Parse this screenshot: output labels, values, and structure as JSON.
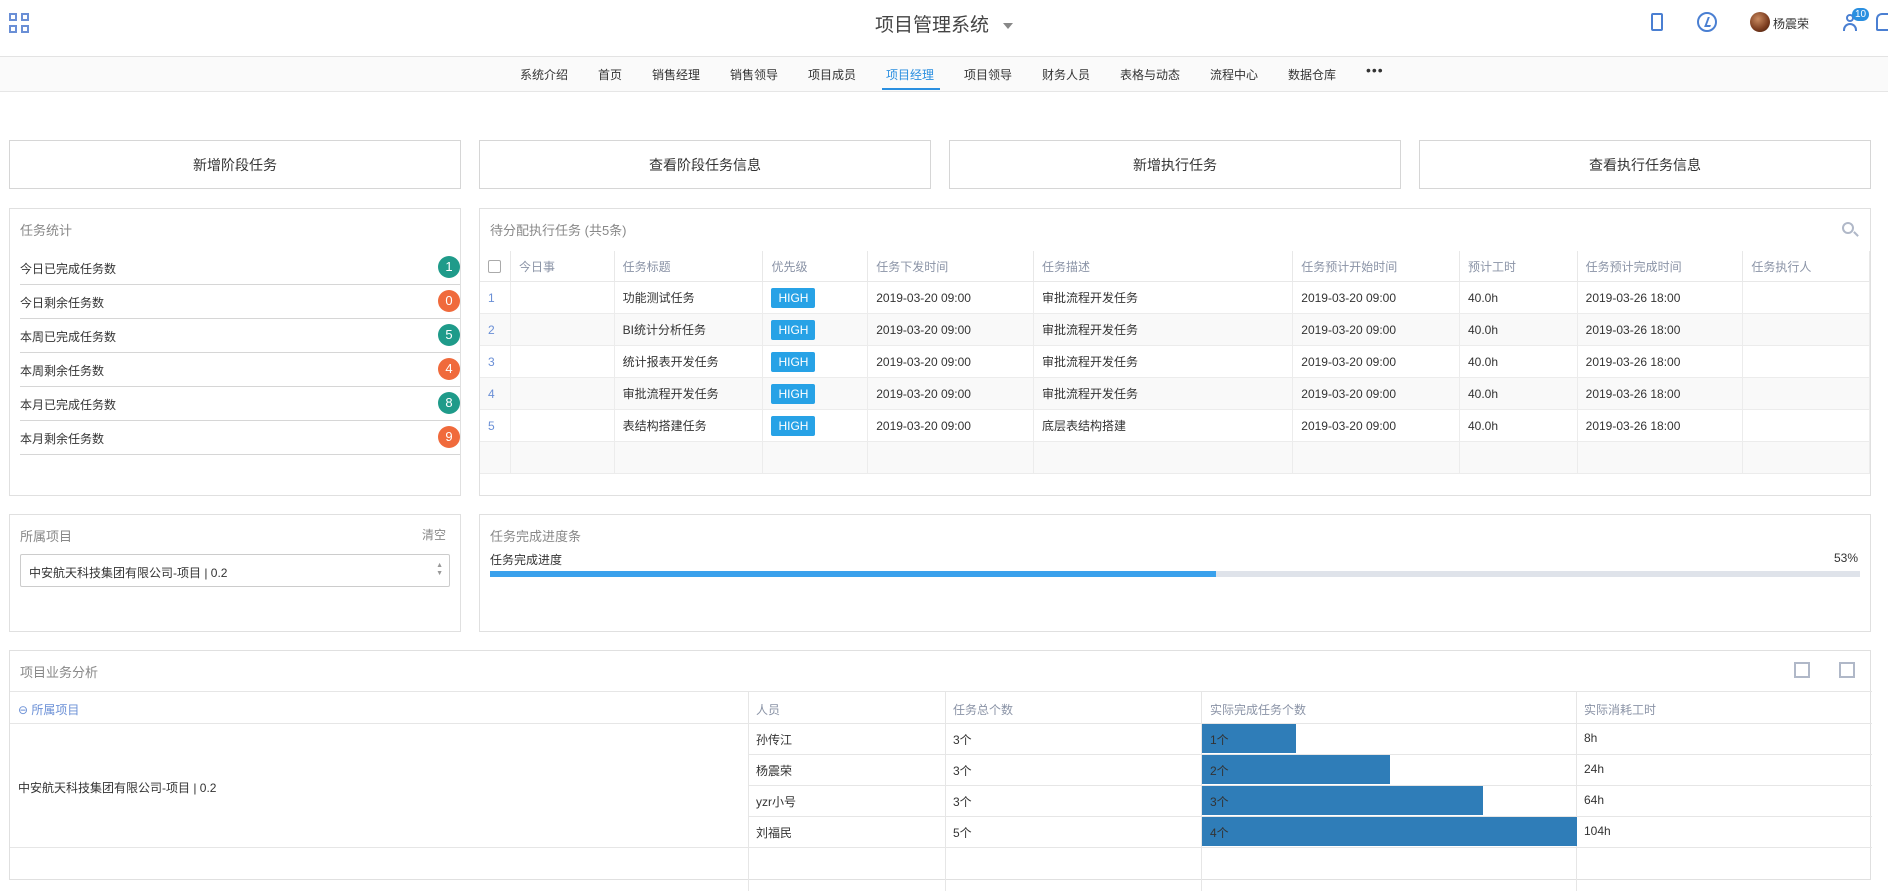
{
  "app": {
    "title": "项目管理系统",
    "user": "杨震荣",
    "notification_count": "10"
  },
  "nav": {
    "items": [
      "系统介绍",
      "首页",
      "销售经理",
      "销售领导",
      "项目成员",
      "项目经理",
      "项目领导",
      "财务人员",
      "表格与动态",
      "流程中心",
      "数据仓库"
    ],
    "active": "项目经理",
    "more": "•••"
  },
  "actions": [
    "新增阶段任务",
    "查看阶段任务信息",
    "新增执行任务",
    "查看执行任务信息"
  ],
  "stats": {
    "title": "任务统计",
    "items": [
      {
        "label": "今日已完成任务数",
        "value": "1",
        "color": "#1f9b8a"
      },
      {
        "label": "今日剩余任务数",
        "value": "0",
        "color": "#f06a3c"
      },
      {
        "label": "本周已完成任务数",
        "value": "5",
        "color": "#1f9b8a"
      },
      {
        "label": "本周剩余任务数",
        "value": "4",
        "color": "#f06a3c"
      },
      {
        "label": "本月已完成任务数",
        "value": "8",
        "color": "#1f9b8a"
      },
      {
        "label": "本月剩余任务数",
        "value": "9",
        "color": "#f06a3c"
      }
    ]
  },
  "tasks": {
    "title": "待分配执行任务 (共5条)",
    "columns": [
      "今日事",
      "任务标题",
      "优先级",
      "任务下发时间",
      "任务描述",
      "任务预计开始时间",
      "预计工时",
      "任务预计完成时间",
      "任务执行人"
    ],
    "rows": [
      {
        "n": "1",
        "title": "功能测试任务",
        "priority": "HIGH",
        "issued": "2019-03-20 09:00",
        "desc": "审批流程开发任务",
        "start": "2019-03-20 09:00",
        "hours": "40.0h",
        "finish": "2019-03-26 18:00"
      },
      {
        "n": "2",
        "title": "BI统计分析任务",
        "priority": "HIGH",
        "issued": "2019-03-20 09:00",
        "desc": "审批流程开发任务",
        "start": "2019-03-20 09:00",
        "hours": "40.0h",
        "finish": "2019-03-26 18:00"
      },
      {
        "n": "3",
        "title": "统计报表开发任务",
        "priority": "HIGH",
        "issued": "2019-03-20 09:00",
        "desc": "审批流程开发任务",
        "start": "2019-03-20 09:00",
        "hours": "40.0h",
        "finish": "2019-03-26 18:00"
      },
      {
        "n": "4",
        "title": "审批流程开发任务",
        "priority": "HIGH",
        "issued": "2019-03-20 09:00",
        "desc": "审批流程开发任务",
        "start": "2019-03-20 09:00",
        "hours": "40.0h",
        "finish": "2019-03-26 18:00"
      },
      {
        "n": "5",
        "title": "表结构搭建任务",
        "priority": "HIGH",
        "issued": "2019-03-20 09:00",
        "desc": "底层表结构搭建",
        "start": "2019-03-20 09:00",
        "hours": "40.0h",
        "finish": "2019-03-26 18:00"
      }
    ]
  },
  "project": {
    "title": "所属项目",
    "clear": "清空",
    "selected": "中安航天科技集团有限公司-项目 | 0.2"
  },
  "progress": {
    "title": "任务完成进度条",
    "label": "任务完成进度",
    "percent_text": "53%",
    "percent": 53
  },
  "analysis": {
    "title": "项目业务分析",
    "col_project": "⊖ 所属项目",
    "columns": [
      "人员",
      "任务总个数",
      "实际完成任务个数",
      "实际消耗工时"
    ],
    "project_name": "中安航天科技集团有限公司-项目 | 0.2",
    "max_completed": 4,
    "rows": [
      {
        "person": "孙传江",
        "total": "3个",
        "done_text": "1个",
        "done": 1,
        "hours": "8h"
      },
      {
        "person": "杨震荣",
        "total": "3个",
        "done_text": "2个",
        "done": 2,
        "hours": "24h"
      },
      {
        "person": "yzr小号",
        "total": "3个",
        "done_text": "3个",
        "done": 3,
        "hours": "64h"
      },
      {
        "person": "刘福民",
        "total": "5个",
        "done_text": "4个",
        "done": 4,
        "hours": "104h"
      }
    ]
  }
}
